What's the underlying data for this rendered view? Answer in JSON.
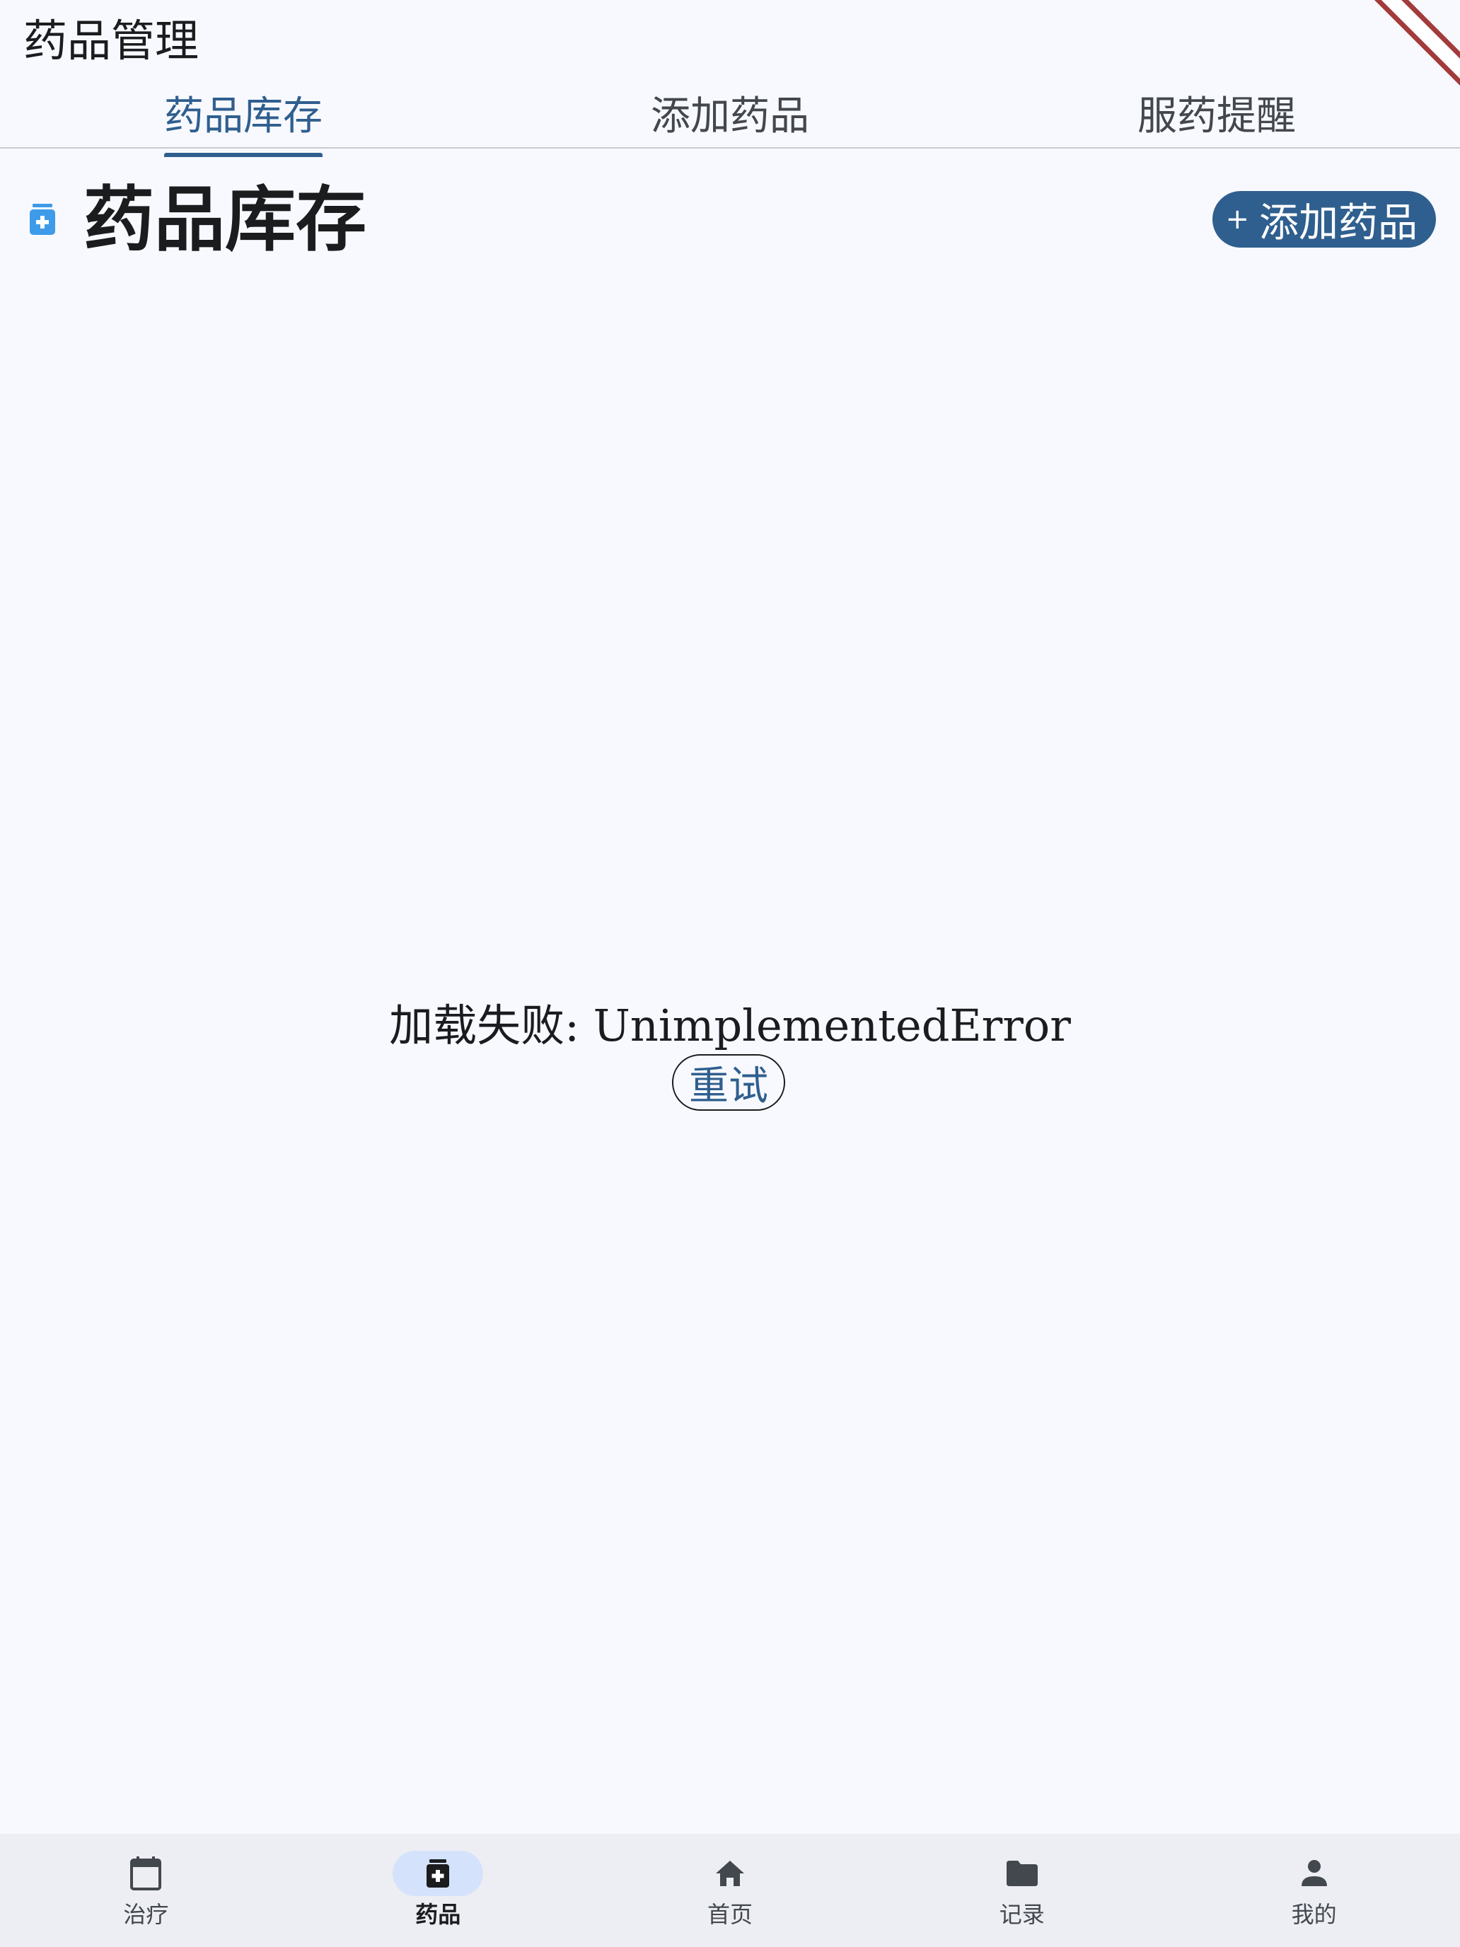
{
  "app_bar": {
    "title": "药品管理"
  },
  "tabs": [
    {
      "label": "药品库存",
      "active": true
    },
    {
      "label": "添加药品",
      "active": false
    },
    {
      "label": "服药提醒",
      "active": false
    }
  ],
  "section": {
    "title": "药品库存",
    "icon": "medication-icon",
    "add_button_label": "添加药品",
    "add_button_icon": "plus-icon"
  },
  "error": {
    "message": "加载失败: UnimplementedError",
    "retry_label": "重试"
  },
  "bottom_nav": [
    {
      "label": "治疗",
      "icon": "calendar-icon",
      "active": false
    },
    {
      "label": "药品",
      "icon": "medication-icon",
      "active": true
    },
    {
      "label": "首页",
      "icon": "home-icon",
      "active": false
    },
    {
      "label": "记录",
      "icon": "folder-icon",
      "active": false
    },
    {
      "label": "我的",
      "icon": "person-icon",
      "active": false
    }
  ],
  "colors": {
    "primary": "#2f5f8e",
    "background": "#f8f9ff",
    "nav_background": "#eceef3",
    "nav_indicator": "#d4e3fb",
    "icon_accent": "#3d9be9",
    "debug_banner": "#a23b3b"
  }
}
